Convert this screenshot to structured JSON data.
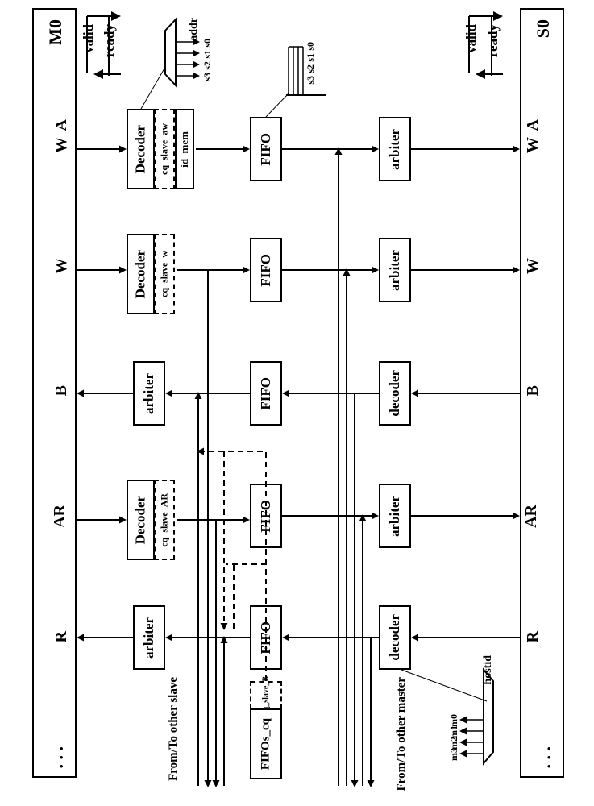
{
  "master": {
    "name": "M0",
    "dots": ". . ."
  },
  "slave": {
    "name": "S0",
    "dots": ". . ."
  },
  "channels": [
    "AW",
    "W",
    "B",
    "AR",
    "R"
  ],
  "channel_display": [
    [
      "A",
      "W"
    ],
    [
      "W"
    ],
    [
      "B"
    ],
    [
      "AR"
    ],
    [
      "R"
    ]
  ],
  "handshake": {
    "valid": "valid",
    "ready": "ready"
  },
  "blocks": {
    "decoder": "Decoder",
    "decoder_lc": "decoder",
    "arbiter": "arbiter",
    "fifo": "FIFO",
    "fifos_cq": "FIFOs_cq",
    "id_mem": "id_mem",
    "cq_slave_aw": "cq_slave_aw",
    "cq_slave_w": "cq_slave_w",
    "cq_slave_ar": "cq_slave_AR",
    "cq_slave_b": "cq_slave_B"
  },
  "addr_decode": {
    "label": "addr",
    "outputs": [
      "s0",
      "s1",
      "s2",
      "s3"
    ]
  },
  "fifo_out_labels": [
    "s0",
    "s1",
    "s2",
    "s3"
  ],
  "hostid_decode": {
    "label": "hostid",
    "outputs": [
      "m0",
      "m1",
      "m2",
      "m3"
    ]
  },
  "other_slave": "From/To other slave",
  "other_master": "From/To other master"
}
